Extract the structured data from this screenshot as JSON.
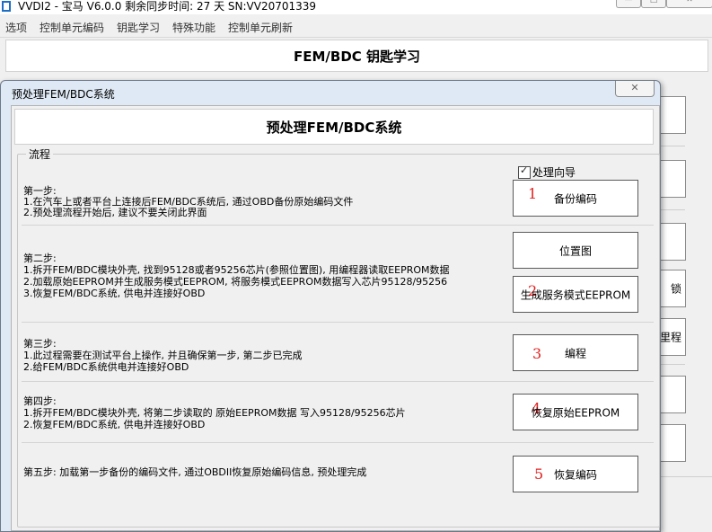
{
  "titlebar": {
    "title": "VVDI2 - 宝马 V6.0.0     剩余同步时间: 27 天     SN:VV20701339",
    "min": "—",
    "max": "□",
    "close": "✕"
  },
  "menu": [
    "选项",
    "控制单元编码",
    "钥匙学习",
    "特殊功能",
    "控制单元刷新"
  ],
  "main": {
    "heading": "FEM/BDC 钥匙学习",
    "partial_buttons": [
      "锁",
      "里程"
    ]
  },
  "dialog": {
    "title": "预处理FEM/BDC系统",
    "close": "✕",
    "heading": "预处理FEM/BDC系统",
    "group_label": "流程",
    "wizard_checked": true,
    "wizard_check_mark": "✓",
    "wizard_label": "处理向导",
    "steps": [
      {
        "title": "第一步:",
        "lines": [
          "1.在汽车上或者平台上连接后FEM/BDC系统后, 通过OBD备份原始编码文件",
          "2.预处理流程开始后, 建议不要关闭此界面"
        ],
        "buttons": [
          {
            "label": "备份编码",
            "marker": "1"
          }
        ]
      },
      {
        "title": "第二步:",
        "lines": [
          "1.拆开FEM/BDC模块外壳, 找到95128或者95256芯片(参照位置图), 用编程器读取EEPROM数据",
          "2.加载原始EEPROM并生成服务模式EEPROM, 将服务模式EEPROM数据写入芯片95128/95256",
          "3.恢复FEM/BDC系统, 供电并连接好OBD"
        ],
        "buttons": [
          {
            "label": "位置图",
            "marker": ""
          },
          {
            "label": "生成服务模式EEPROM",
            "marker": "2"
          }
        ]
      },
      {
        "title": "第三步:",
        "lines": [
          "1.此过程需要在测试平台上操作, 并且确保第一步, 第二步已完成",
          "2.给FEM/BDC系统供电并连接好OBD"
        ],
        "buttons": [
          {
            "label": "编程",
            "marker": "3"
          }
        ]
      },
      {
        "title": "第四步:",
        "lines": [
          "1.拆开FEM/BDC模块外壳, 将第二步读取的 原始EEPROM数据 写入95128/95256芯片",
          "2.恢复FEM/BDC系统, 供电并连接好OBD"
        ],
        "buttons": [
          {
            "label": "恢复原始EEPROM",
            "marker": "4"
          }
        ]
      },
      {
        "title": "第五步: 加载第一步备份的编码文件, 通过OBDII恢复原始编码信息, 预处理完成",
        "lines": [],
        "buttons": [
          {
            "label": "恢复编码",
            "marker": "5"
          }
        ]
      }
    ]
  },
  "colors": {
    "marker": "#e02020",
    "dialog_frame": "#dfe9f5"
  }
}
